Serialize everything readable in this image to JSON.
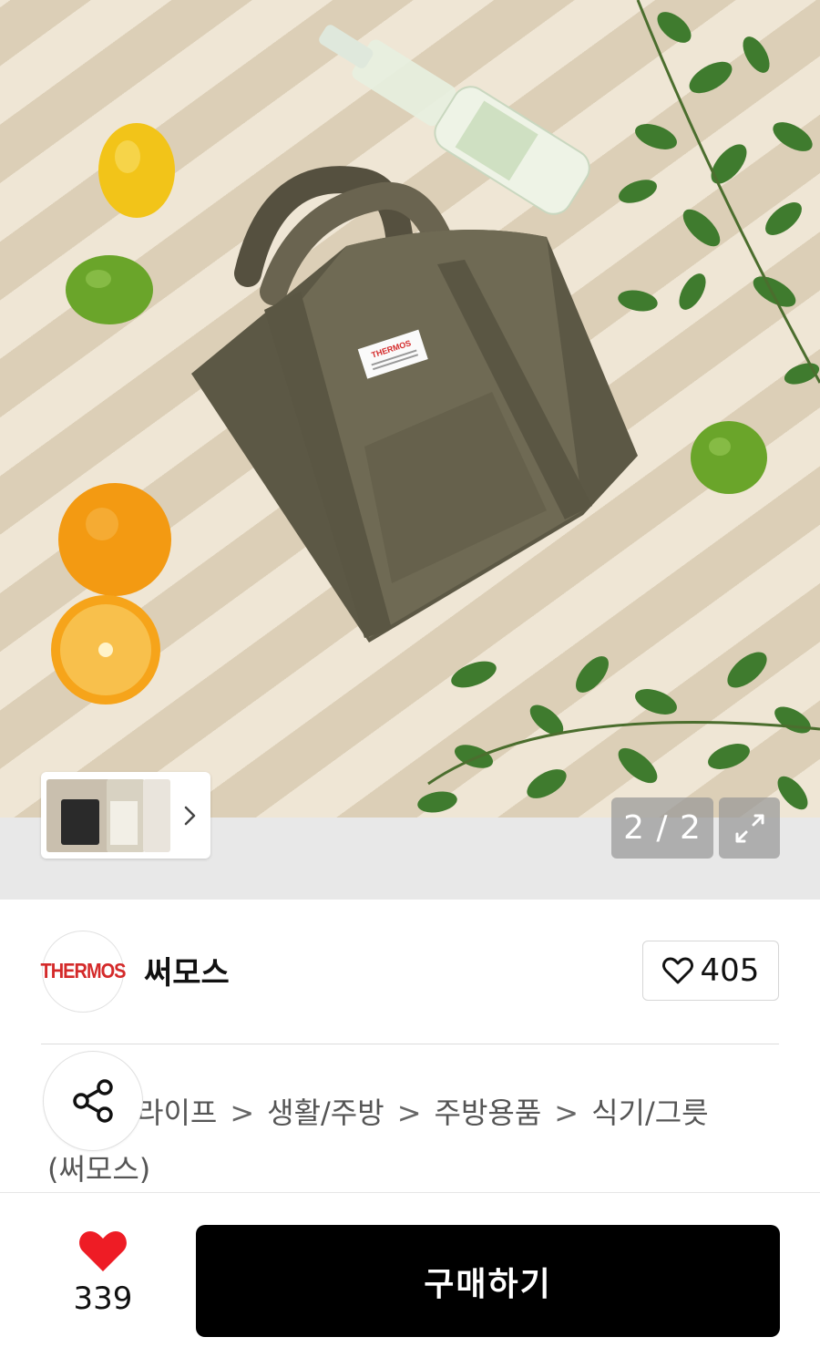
{
  "gallery": {
    "counter": "2 / 2",
    "image_alt": "Thermos khaki lunch tote bag product photo"
  },
  "brand": {
    "logo_text": "THERMOS",
    "name": "써모스",
    "follow_count": "405"
  },
  "category": {
    "items": [
      "라이프",
      "생활/주방",
      "주방용품",
      "식기/그릇"
    ],
    "separator": ">",
    "suffix": "(써모스)"
  },
  "bottom_bar": {
    "like_count": "339",
    "buy_label": "구매하기",
    "like_color": "#ee1c25"
  }
}
